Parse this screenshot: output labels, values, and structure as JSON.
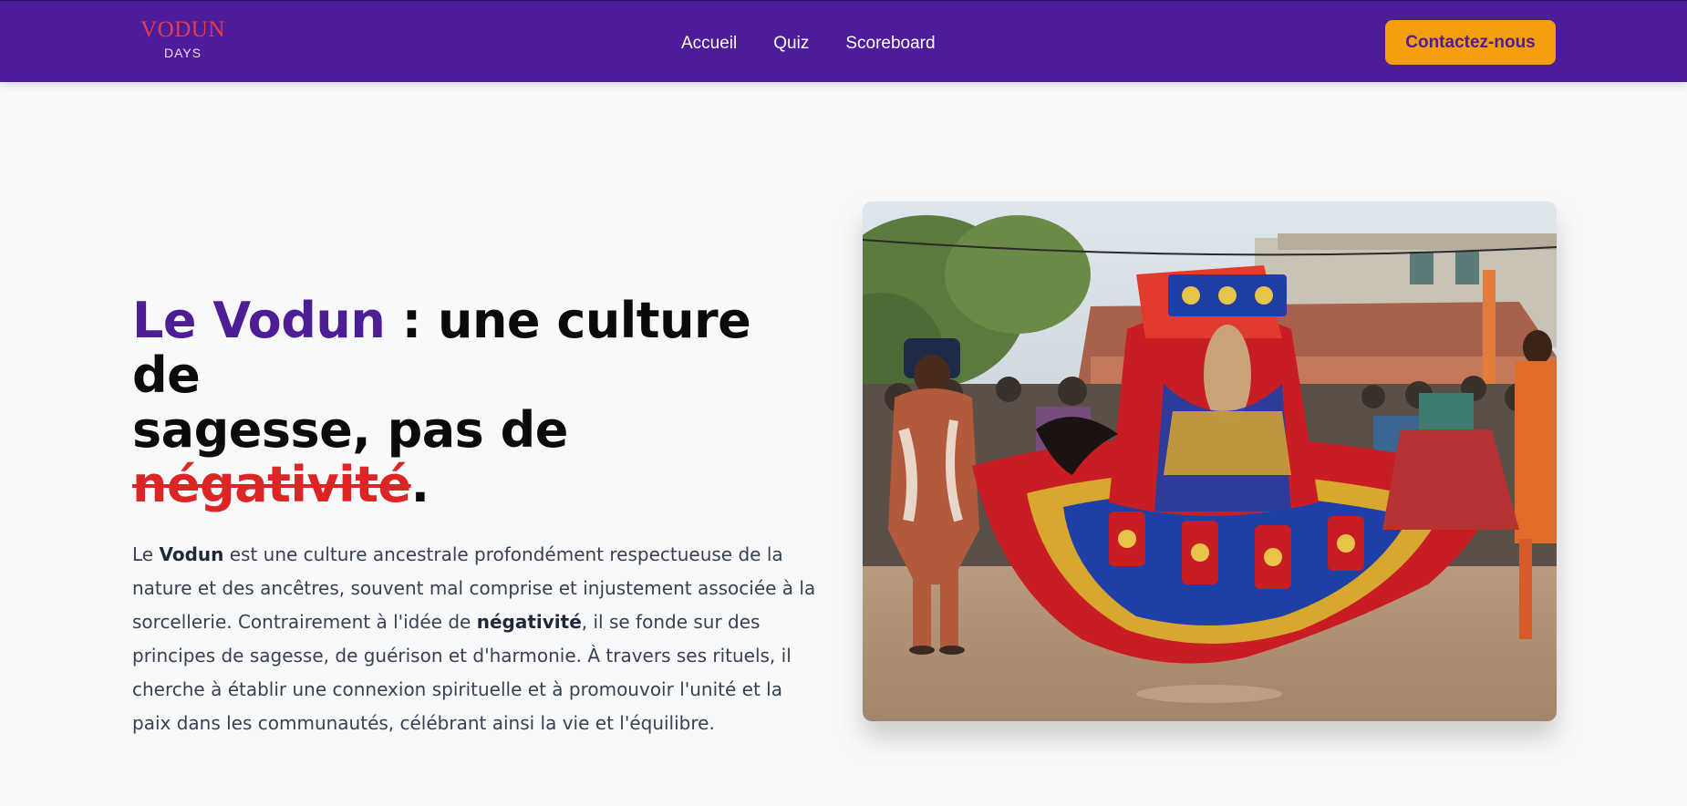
{
  "navbar": {
    "logo": {
      "top": "VODUN",
      "bottom": "DAYS"
    },
    "links": [
      "Accueil",
      "Quiz",
      "Scoreboard"
    ],
    "contact_label": "Contactez-nous"
  },
  "hero": {
    "title": {
      "accent": "Le Vodun",
      "part1": " : une culture de",
      "part2": "sagesse, pas de ",
      "struck": "négativité",
      "end": "."
    },
    "description": {
      "p1": "Le ",
      "b1": "Vodun",
      "p2": " est une culture ancestrale profondément respectueuse de la nature et des ancêtres, souvent mal comprise et injustement associée à la sorcellerie. Contrairement à l'idée de ",
      "b2": "négativité",
      "p3": ", il se fonde sur des principes de sagesse, de guérison et d'harmonie. À travers ses rituels, il cherche à établir une connexion spirituelle et à promouvoir l'unité et la paix dans les communautés, célébrant ainsi la vie et l'équilibre."
    }
  },
  "colors": {
    "navbar_bg": "#4d1c9a",
    "accent_purple": "#4c1d95",
    "cta_bg": "#f59e0b",
    "strike_red": "#dc2626",
    "logo_red": "#e43d4f"
  }
}
